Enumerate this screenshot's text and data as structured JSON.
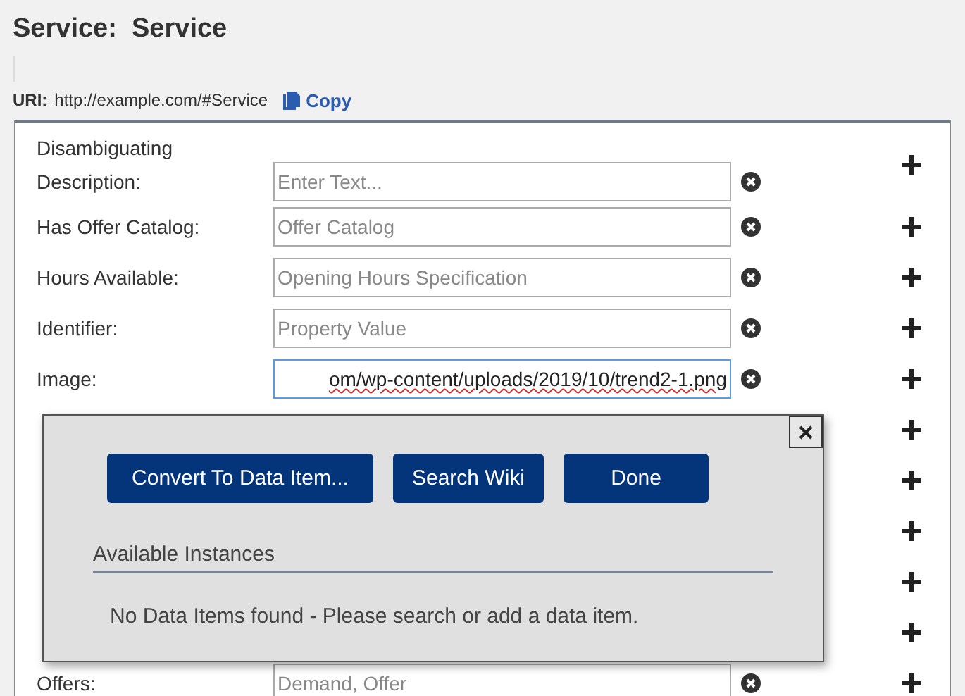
{
  "title": "Service:  Service",
  "uri": {
    "label": "URI:",
    "value": "http://example.com/#Service",
    "copy": "Copy"
  },
  "rows": [
    {
      "kind": "field",
      "label": "Disambiguating Description:",
      "placeholder": "Enter Text..."
    },
    {
      "kind": "field",
      "label": "Has Offer Catalog:",
      "placeholder": "Offer Catalog"
    },
    {
      "kind": "field",
      "label": "Hours Available:",
      "placeholder": "Opening Hours Specification"
    },
    {
      "kind": "field",
      "label": "Identifier:",
      "placeholder": "Property Value"
    },
    {
      "kind": "field",
      "label": "Image:",
      "value": "om/wp-content/uploads/2019/10/trend2-1.png",
      "focused": true
    },
    {
      "kind": "covered"
    },
    {
      "kind": "covered"
    },
    {
      "kind": "covered"
    },
    {
      "kind": "covered"
    },
    {
      "kind": "covered"
    },
    {
      "kind": "field",
      "label": "Offers:",
      "placeholder": "Demand, Offer"
    }
  ],
  "popup": {
    "buttons": [
      "Convert To Data Item...",
      "Search Wiki",
      "Done"
    ],
    "heading": "Available Instances",
    "message": "No Data Items found - Please search or add a data item."
  }
}
